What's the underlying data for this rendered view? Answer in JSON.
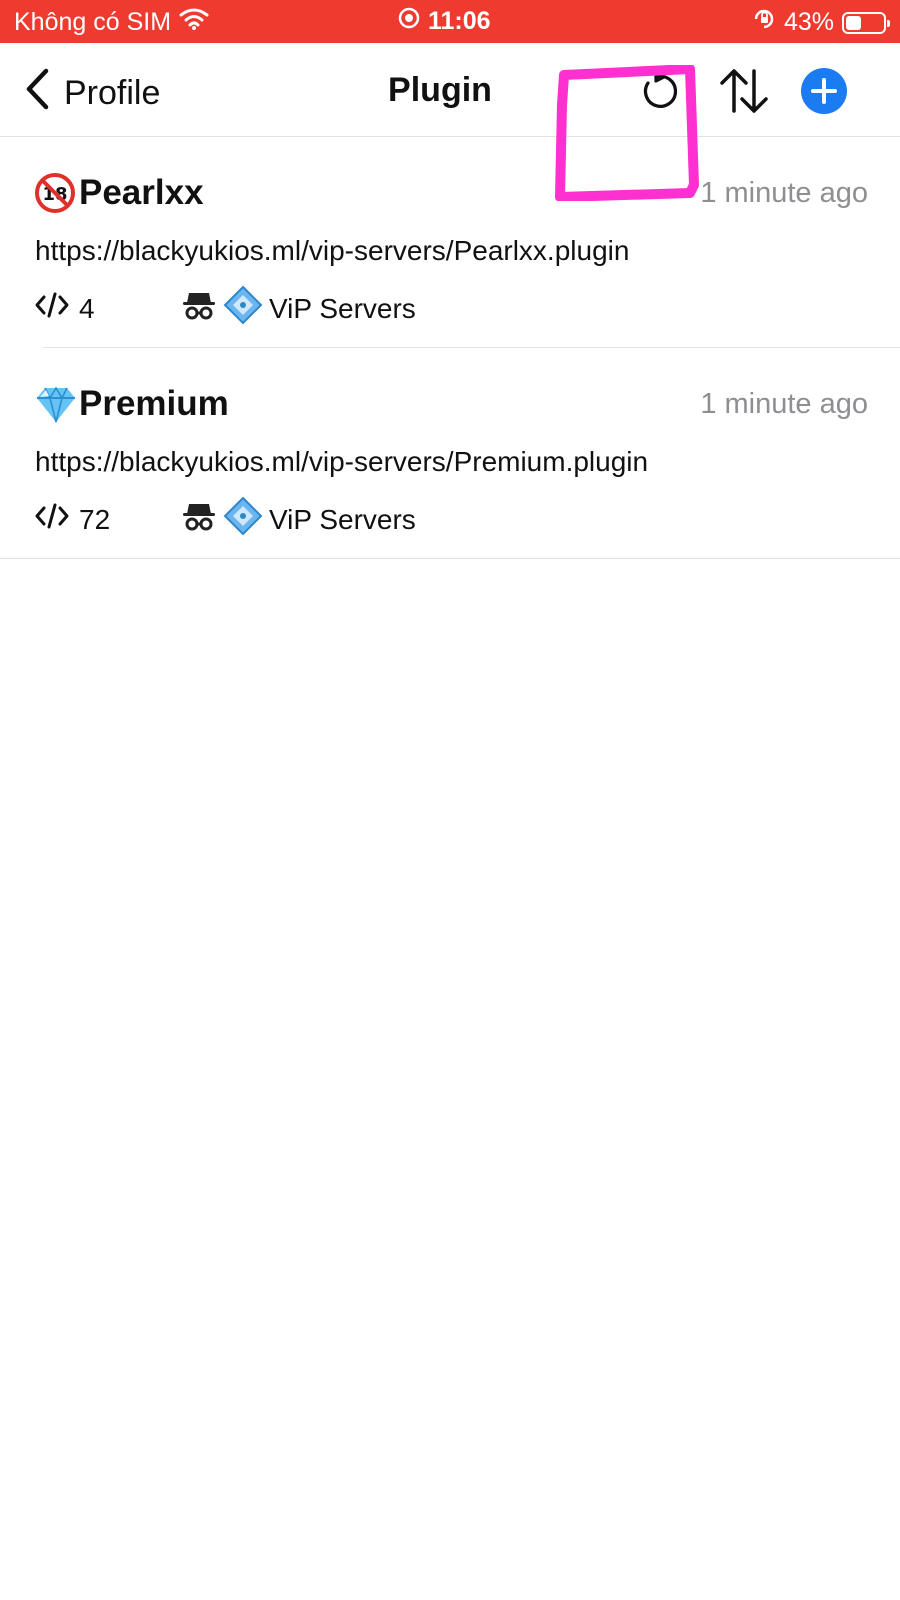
{
  "status_bar": {
    "carrier": "Không có SIM",
    "time": "11:06",
    "battery_percent": "43%",
    "battery_level": 0.43,
    "background_color": "#ee3a2f"
  },
  "nav": {
    "back_label": "Profile",
    "title": "Plugin",
    "icons": [
      "back-chevron-icon",
      "refresh-icon",
      "sort-icon",
      "add-icon"
    ],
    "accent_color": "#1a7cf0"
  },
  "annotation": {
    "highlight_target": "refresh-icon",
    "color": "#ff2fd0"
  },
  "plugins": [
    {
      "emoji": "no-under-18-icon",
      "name": "Pearlxx",
      "time": "1 minute ago",
      "url": "https://blackyukios.ml/vip-servers/Pearlxx.plugin",
      "count": "4",
      "owner_emojis": [
        "detective-icon",
        "diamond-shape-icon"
      ],
      "owner": "ViP Servers"
    },
    {
      "emoji": "gem-icon",
      "name": "Premium",
      "time": "1 minute ago",
      "url": "https://blackyukios.ml/vip-servers/Premium.plugin",
      "count": "72",
      "owner_emojis": [
        "detective-icon",
        "diamond-shape-icon"
      ],
      "owner": "ViP Servers"
    }
  ]
}
